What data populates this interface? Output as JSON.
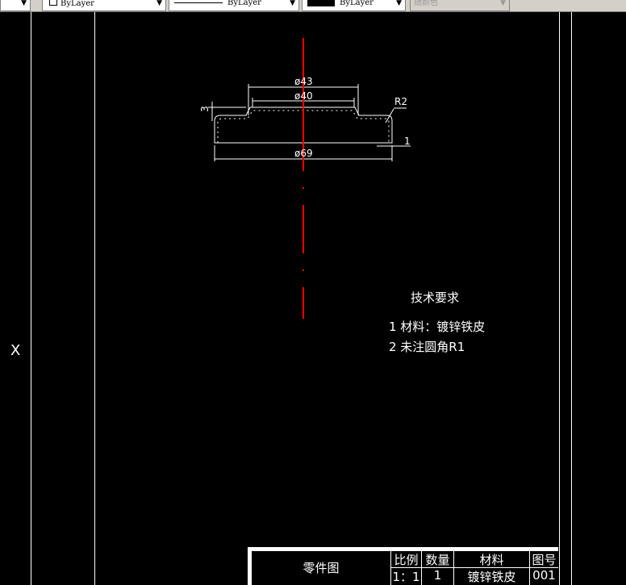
{
  "toolbar": {
    "color": "ByLayer",
    "linetype": "ByLayer",
    "lineweight": "ByLayer",
    "plotstyle": "随颜色"
  },
  "drawing": {
    "dimensions": {
      "d43": "ø43",
      "d40": "ø40",
      "d69": "ø69",
      "r2": "R2",
      "h3": "3",
      "t1": "1"
    },
    "centerline_color": "#ff0000",
    "ucs_label": "X"
  },
  "notes": {
    "title": "技术要求",
    "items": [
      "1 材料：镀锌铁皮",
      "2 未注圆角R1"
    ]
  },
  "title_block": {
    "name": "零件图",
    "headers": [
      "比例",
      "数量",
      "材料",
      "图号"
    ],
    "values": [
      "1：1",
      "1",
      "镀锌铁皮",
      "001"
    ]
  }
}
